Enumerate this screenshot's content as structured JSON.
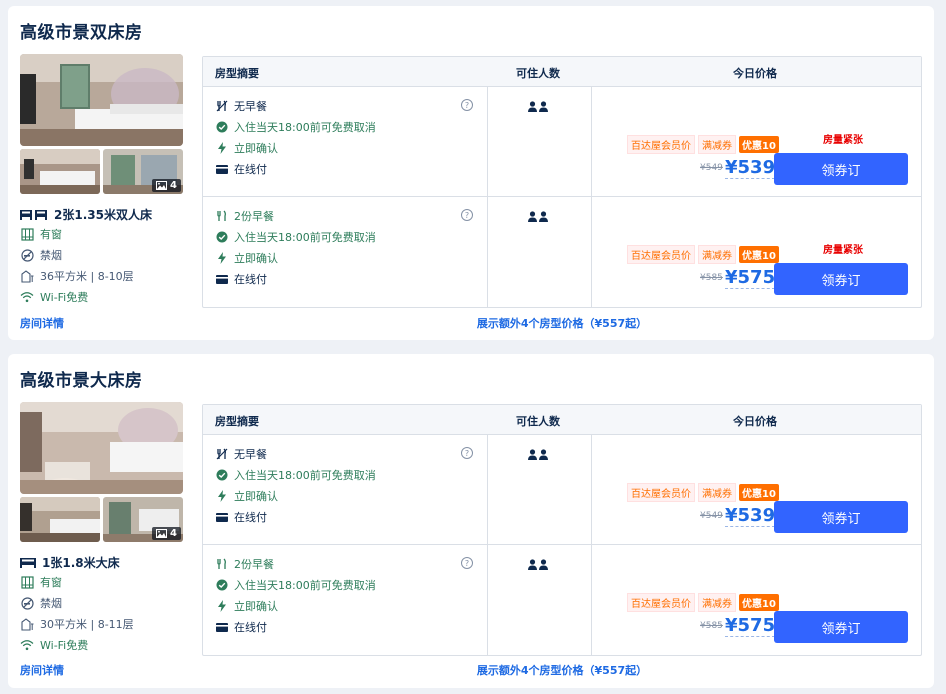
{
  "colors": {
    "accent": "#3264ff",
    "link": "#1e6ae3",
    "green": "#2e7d5b",
    "orange": "#ff6f00",
    "red": "#e80000"
  },
  "table_headers": {
    "summary": "房型摘要",
    "guests": "可住人数",
    "price": "今日价格"
  },
  "rooms": [
    {
      "title": "高级市景双床房",
      "photo_count": "4",
      "bed": "2张1.35米双人床",
      "bed_icon": "twin-bed-icon",
      "amenities": {
        "window": "有窗",
        "smoking": "禁烟",
        "area_floor": "36平方米 | 8-10层",
        "wifi": "Wi-Fi免费"
      },
      "detail_link": "房间详情",
      "more_link": "展示额外4个房型价格（¥557起）",
      "rates": [
        {
          "meal": "无早餐",
          "cancel": "入住当天18:00前可免费取消",
          "confirm": "立即确认",
          "pay": "在线付",
          "tag_member": "百达屋会员价",
          "tag_coupon": "满减券",
          "tag_discount": "优惠10",
          "scarce": "房量紧张",
          "old_price": "¥549",
          "price": "¥539",
          "book": "领券订"
        },
        {
          "meal": "2份早餐",
          "cancel": "入住当天18:00前可免费取消",
          "confirm": "立即确认",
          "pay": "在线付",
          "tag_member": "百达屋会员价",
          "tag_coupon": "满减券",
          "tag_discount": "优惠10",
          "scarce": "房量紧张",
          "old_price": "¥585",
          "price": "¥575",
          "book": "领券订"
        }
      ]
    },
    {
      "title": "高级市景大床房",
      "photo_count": "4",
      "bed": "1张1.8米大床",
      "bed_icon": "double-bed-icon",
      "amenities": {
        "window": "有窗",
        "smoking": "禁烟",
        "area_floor": "30平方米 | 8-11层",
        "wifi": "Wi-Fi免费"
      },
      "detail_link": "房间详情",
      "more_link": "展示额外4个房型价格（¥557起）",
      "rates": [
        {
          "meal": "无早餐",
          "cancel": "入住当天18:00前可免费取消",
          "confirm": "立即确认",
          "pay": "在线付",
          "tag_member": "百达屋会员价",
          "tag_coupon": "满减券",
          "tag_discount": "优惠10",
          "old_price": "¥549",
          "price": "¥539",
          "book": "领券订"
        },
        {
          "meal": "2份早餐",
          "cancel": "入住当天18:00前可免费取消",
          "confirm": "立即确认",
          "pay": "在线付",
          "tag_member": "百达屋会员价",
          "tag_coupon": "满减券",
          "tag_discount": "优惠10",
          "old_price": "¥585",
          "price": "¥575",
          "book": "领券订"
        }
      ]
    }
  ]
}
